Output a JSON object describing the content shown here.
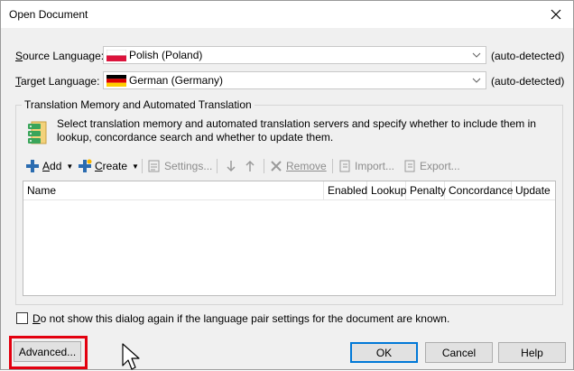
{
  "window": {
    "title": "Open Document"
  },
  "source": {
    "label_prefix": "S",
    "label_rest": "ource Language:",
    "value": "Polish (Poland)",
    "flag": "poland-flag",
    "auto": "(auto-detected)"
  },
  "target": {
    "label_prefix": "T",
    "label_rest": "arget Language:",
    "value": "German (Germany)",
    "flag": "germany-flag",
    "auto": "(auto-detected)"
  },
  "group": {
    "title": "Translation Memory and Automated Translation",
    "description": "Select translation memory and automated translation servers and specify whether to include them in lookup, concordance search and whether to update them."
  },
  "toolbar": {
    "add_prefix": "A",
    "add_rest": "dd",
    "create_prefix": "C",
    "create_rest": "reate",
    "settings": "Settings...",
    "remove": "Remove",
    "import": "Import...",
    "export": "Export..."
  },
  "grid": {
    "columns": [
      "Name",
      "Enabled",
      "Lookup",
      "Penalty",
      "Concordance",
      "Update"
    ],
    "rows": []
  },
  "checkbox": {
    "label_prefix": "D",
    "label_rest": "o not show this dialog again if the language pair settings for the document are known.",
    "checked": false
  },
  "buttons": {
    "advanced": "Advanced...",
    "ok": "OK",
    "cancel": "Cancel",
    "help": "Help"
  },
  "colors": {
    "highlight": "#e3000f",
    "default_button_border": "#0078d7",
    "add_icon": "#2b6cb0"
  }
}
